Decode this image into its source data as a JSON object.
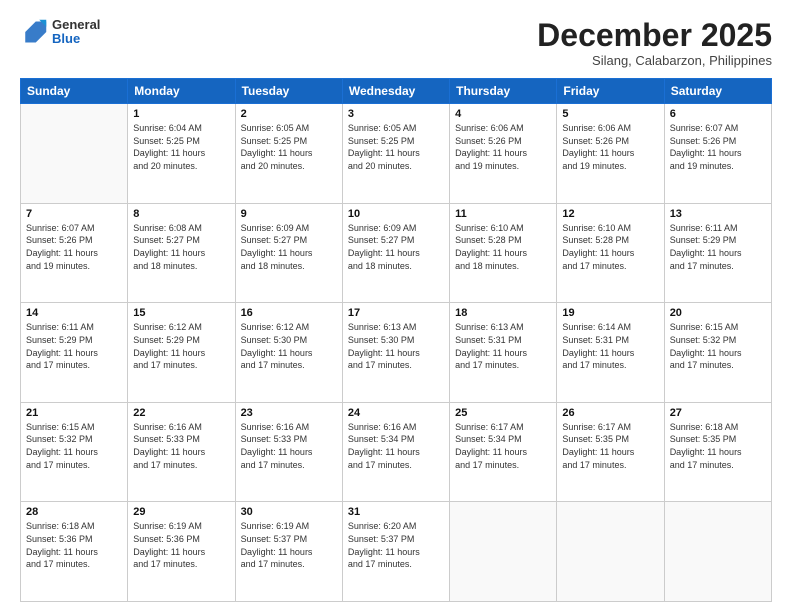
{
  "logo": {
    "general": "General",
    "blue": "Blue"
  },
  "header": {
    "month": "December 2025",
    "location": "Silang, Calabarzon, Philippines"
  },
  "days": [
    "Sunday",
    "Monday",
    "Tuesday",
    "Wednesday",
    "Thursday",
    "Friday",
    "Saturday"
  ],
  "weeks": [
    [
      {
        "day": "",
        "info": ""
      },
      {
        "day": "1",
        "info": "Sunrise: 6:04 AM\nSunset: 5:25 PM\nDaylight: 11 hours\nand 20 minutes."
      },
      {
        "day": "2",
        "info": "Sunrise: 6:05 AM\nSunset: 5:25 PM\nDaylight: 11 hours\nand 20 minutes."
      },
      {
        "day": "3",
        "info": "Sunrise: 6:05 AM\nSunset: 5:25 PM\nDaylight: 11 hours\nand 20 minutes."
      },
      {
        "day": "4",
        "info": "Sunrise: 6:06 AM\nSunset: 5:26 PM\nDaylight: 11 hours\nand 19 minutes."
      },
      {
        "day": "5",
        "info": "Sunrise: 6:06 AM\nSunset: 5:26 PM\nDaylight: 11 hours\nand 19 minutes."
      },
      {
        "day": "6",
        "info": "Sunrise: 6:07 AM\nSunset: 5:26 PM\nDaylight: 11 hours\nand 19 minutes."
      }
    ],
    [
      {
        "day": "7",
        "info": "Sunrise: 6:07 AM\nSunset: 5:26 PM\nDaylight: 11 hours\nand 19 minutes."
      },
      {
        "day": "8",
        "info": "Sunrise: 6:08 AM\nSunset: 5:27 PM\nDaylight: 11 hours\nand 18 minutes."
      },
      {
        "day": "9",
        "info": "Sunrise: 6:09 AM\nSunset: 5:27 PM\nDaylight: 11 hours\nand 18 minutes."
      },
      {
        "day": "10",
        "info": "Sunrise: 6:09 AM\nSunset: 5:27 PM\nDaylight: 11 hours\nand 18 minutes."
      },
      {
        "day": "11",
        "info": "Sunrise: 6:10 AM\nSunset: 5:28 PM\nDaylight: 11 hours\nand 18 minutes."
      },
      {
        "day": "12",
        "info": "Sunrise: 6:10 AM\nSunset: 5:28 PM\nDaylight: 11 hours\nand 17 minutes."
      },
      {
        "day": "13",
        "info": "Sunrise: 6:11 AM\nSunset: 5:29 PM\nDaylight: 11 hours\nand 17 minutes."
      }
    ],
    [
      {
        "day": "14",
        "info": "Sunrise: 6:11 AM\nSunset: 5:29 PM\nDaylight: 11 hours\nand 17 minutes."
      },
      {
        "day": "15",
        "info": "Sunrise: 6:12 AM\nSunset: 5:29 PM\nDaylight: 11 hours\nand 17 minutes."
      },
      {
        "day": "16",
        "info": "Sunrise: 6:12 AM\nSunset: 5:30 PM\nDaylight: 11 hours\nand 17 minutes."
      },
      {
        "day": "17",
        "info": "Sunrise: 6:13 AM\nSunset: 5:30 PM\nDaylight: 11 hours\nand 17 minutes."
      },
      {
        "day": "18",
        "info": "Sunrise: 6:13 AM\nSunset: 5:31 PM\nDaylight: 11 hours\nand 17 minutes."
      },
      {
        "day": "19",
        "info": "Sunrise: 6:14 AM\nSunset: 5:31 PM\nDaylight: 11 hours\nand 17 minutes."
      },
      {
        "day": "20",
        "info": "Sunrise: 6:15 AM\nSunset: 5:32 PM\nDaylight: 11 hours\nand 17 minutes."
      }
    ],
    [
      {
        "day": "21",
        "info": "Sunrise: 6:15 AM\nSunset: 5:32 PM\nDaylight: 11 hours\nand 17 minutes."
      },
      {
        "day": "22",
        "info": "Sunrise: 6:16 AM\nSunset: 5:33 PM\nDaylight: 11 hours\nand 17 minutes."
      },
      {
        "day": "23",
        "info": "Sunrise: 6:16 AM\nSunset: 5:33 PM\nDaylight: 11 hours\nand 17 minutes."
      },
      {
        "day": "24",
        "info": "Sunrise: 6:16 AM\nSunset: 5:34 PM\nDaylight: 11 hours\nand 17 minutes."
      },
      {
        "day": "25",
        "info": "Sunrise: 6:17 AM\nSunset: 5:34 PM\nDaylight: 11 hours\nand 17 minutes."
      },
      {
        "day": "26",
        "info": "Sunrise: 6:17 AM\nSunset: 5:35 PM\nDaylight: 11 hours\nand 17 minutes."
      },
      {
        "day": "27",
        "info": "Sunrise: 6:18 AM\nSunset: 5:35 PM\nDaylight: 11 hours\nand 17 minutes."
      }
    ],
    [
      {
        "day": "28",
        "info": "Sunrise: 6:18 AM\nSunset: 5:36 PM\nDaylight: 11 hours\nand 17 minutes."
      },
      {
        "day": "29",
        "info": "Sunrise: 6:19 AM\nSunset: 5:36 PM\nDaylight: 11 hours\nand 17 minutes."
      },
      {
        "day": "30",
        "info": "Sunrise: 6:19 AM\nSunset: 5:37 PM\nDaylight: 11 hours\nand 17 minutes."
      },
      {
        "day": "31",
        "info": "Sunrise: 6:20 AM\nSunset: 5:37 PM\nDaylight: 11 hours\nand 17 minutes."
      },
      {
        "day": "",
        "info": ""
      },
      {
        "day": "",
        "info": ""
      },
      {
        "day": "",
        "info": ""
      }
    ]
  ]
}
